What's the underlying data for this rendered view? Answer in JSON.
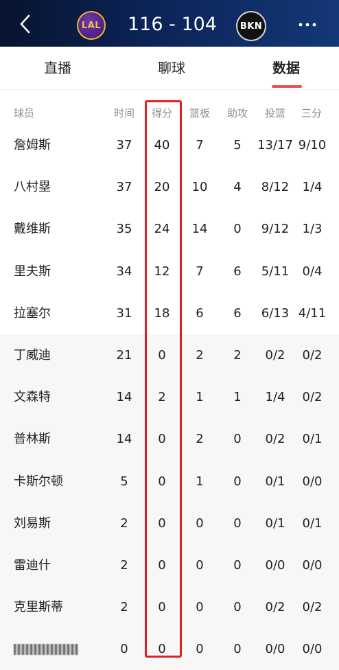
{
  "header": {
    "home_team_abbr": "LAL",
    "away_team_abbr": "BKN",
    "score": "116 - 104"
  },
  "tabs": [
    {
      "label": "直播",
      "active": false
    },
    {
      "label": "聊球",
      "active": false
    },
    {
      "label": "数据",
      "active": true
    }
  ],
  "table": {
    "columns": [
      "球员",
      "时间",
      "得分",
      "篮板",
      "助攻",
      "投篮",
      "三分"
    ],
    "rows": [
      {
        "name": "詹姆斯",
        "min": "37",
        "pts": "40",
        "reb": "7",
        "ast": "5",
        "fg": "13/17",
        "tp": "9/10"
      },
      {
        "name": "八村塁",
        "min": "37",
        "pts": "20",
        "reb": "10",
        "ast": "4",
        "fg": "8/12",
        "tp": "1/4"
      },
      {
        "name": "戴维斯",
        "min": "35",
        "pts": "24",
        "reb": "14",
        "ast": "0",
        "fg": "9/12",
        "tp": "1/3"
      },
      {
        "name": "里夫斯",
        "min": "34",
        "pts": "12",
        "reb": "7",
        "ast": "6",
        "fg": "5/11",
        "tp": "0/4"
      },
      {
        "name": "拉塞尔",
        "min": "31",
        "pts": "18",
        "reb": "6",
        "ast": "6",
        "fg": "6/13",
        "tp": "4/11"
      },
      {
        "name": "丁威迪",
        "min": "21",
        "pts": "0",
        "reb": "2",
        "ast": "2",
        "fg": "0/2",
        "tp": "0/2"
      },
      {
        "name": "文森特",
        "min": "14",
        "pts": "2",
        "reb": "1",
        "ast": "1",
        "fg": "1/4",
        "tp": "0/2"
      },
      {
        "name": "普林斯",
        "min": "14",
        "pts": "0",
        "reb": "2",
        "ast": "0",
        "fg": "0/2",
        "tp": "0/1"
      },
      {
        "name": "卡斯尔顿",
        "min": "5",
        "pts": "0",
        "reb": "1",
        "ast": "0",
        "fg": "0/1",
        "tp": "0/0"
      },
      {
        "name": "刘易斯",
        "min": "2",
        "pts": "0",
        "reb": "0",
        "ast": "0",
        "fg": "0/1",
        "tp": "0/1"
      },
      {
        "name": "雷迪什",
        "min": "2",
        "pts": "0",
        "reb": "0",
        "ast": "0",
        "fg": "0/0",
        "tp": "0/0"
      },
      {
        "name": "克里斯蒂",
        "min": "2",
        "pts": "0",
        "reb": "0",
        "ast": "0",
        "fg": "0/2",
        "tp": "0/2"
      },
      {
        "name": "",
        "min": "0",
        "pts": "0",
        "reb": "0",
        "ast": "0",
        "fg": "0/0",
        "tp": "0/0",
        "name_obscured": true
      }
    ]
  },
  "colors": {
    "header_bg": "#0c2457",
    "tab_underline": "#e8545a",
    "highlight_box": "#e02020",
    "bench_row_bg": "#f7f7f7"
  },
  "icons": {
    "back": "chevron-left-icon",
    "more": "more-dots-icon"
  }
}
